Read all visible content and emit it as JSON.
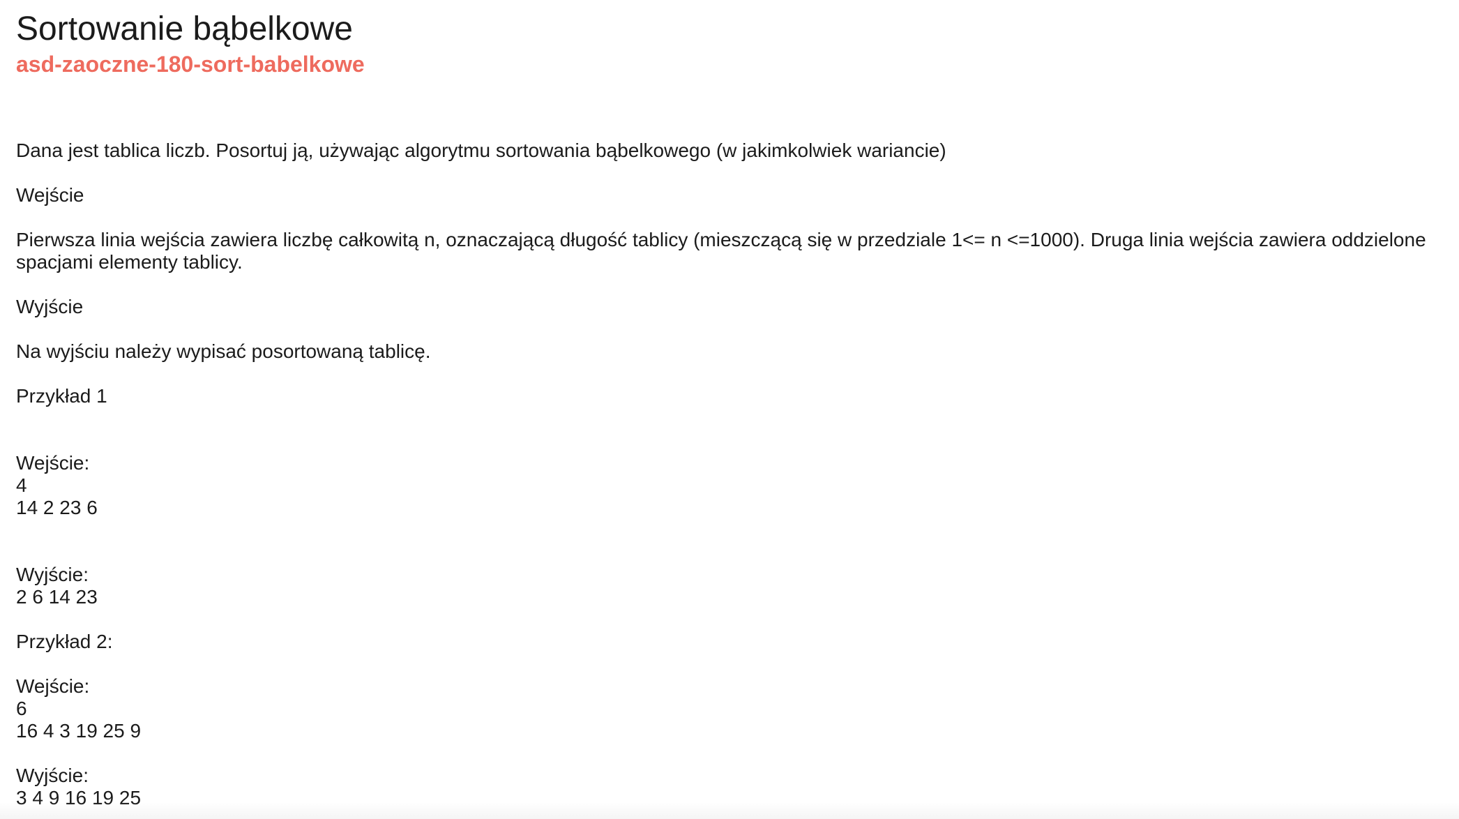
{
  "header": {
    "title": "Sortowanie bąbelkowe",
    "slug": "asd-zaoczne-180-sort-babelkowe"
  },
  "problem": {
    "description": "Dana jest tablica liczb. Posortuj ją, używając algorytmu sortowania bąbelkowego (w jakimkolwiek wariancie)",
    "input_heading": "Wejście",
    "input_text": "Pierwsza linia wejścia zawiera liczbę całkowitą n, oznaczającą długość tablicy (mieszczącą się w przedziale 1<= n <=1000). Druga linia wejścia zawiera oddzielone spacjami elementy tablicy.",
    "output_heading": "Wyjście",
    "output_text": "Na wyjściu należy wypisać posortowaną tablicę."
  },
  "examples": [
    {
      "heading": "Przykład 1",
      "input_label": "Wejście:",
      "input_lines": [
        "4",
        "14 2 23 6"
      ],
      "output_label": "Wyjście:",
      "output_lines": [
        "2 6 14 23"
      ]
    },
    {
      "heading": "Przykład 2:",
      "input_label": "Wejście:",
      "input_lines": [
        "6",
        "16 4 3 19 25 9"
      ],
      "output_label": "Wyjście:",
      "output_lines": [
        "3 4 9 16 19 25"
      ]
    }
  ]
}
